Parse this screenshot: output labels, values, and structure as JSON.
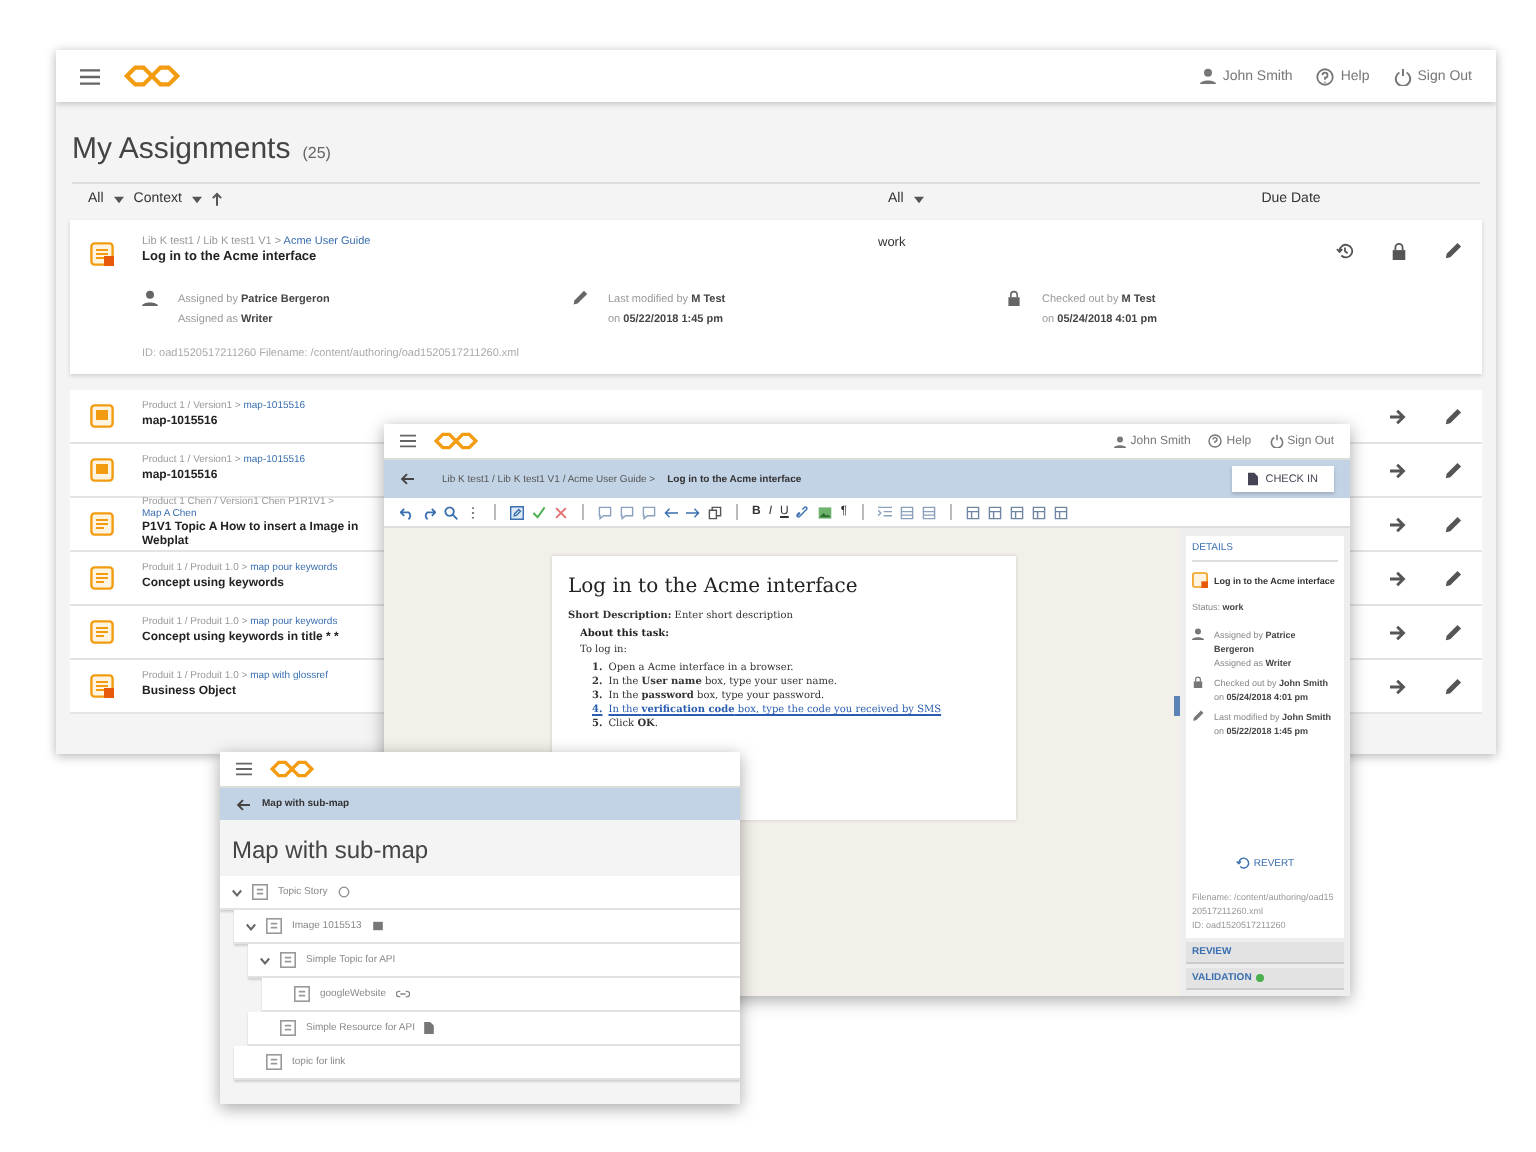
{
  "main_window": {
    "header": {
      "user": "John Smith",
      "help": "Help",
      "sign_out": "Sign Out"
    },
    "title": "My Assignments",
    "count": "(25)",
    "filters": {
      "select_all": "All",
      "context": "Context",
      "status": "All",
      "due_date": "Due Date"
    },
    "featured": {
      "kind": "task",
      "path": "Lib K test1 / Lib K test1 V1 >",
      "link": "Acme User Guide",
      "title": "Log in to the Acme interface",
      "status": "work",
      "assigned_by": "Assigned by **Patrice Bergeron**",
      "assigned_as": "Assigned as **Writer**",
      "modified_by": "Last modified by **M Test**",
      "modified_on": "on **05/22/2018 1:45 pm**",
      "checked_out_by": "Checked out by **M Test**",
      "checked_out_on": "on **05/24/2018 4:01 pm**",
      "ids": "ID: oad1520517211260   Filename: /content/authoring/oad1520517211260.xml"
    },
    "assignments": [
      {
        "kind": "map",
        "path": "Product 1 / Version1 >",
        "link": "map-1015516",
        "title": "map-1015516"
      },
      {
        "kind": "map",
        "path": "Product 1 / Version1 >",
        "link": "map-1015516",
        "title": "map-1015516"
      },
      {
        "kind": "topic",
        "path": "Product 1 Chen / Version1 Chen P1R1V1 >",
        "link": "Map A Chen",
        "title": "P1V1 Topic A How to insert a Image in Webplat"
      },
      {
        "kind": "topic",
        "path": "Produit 1 / Produit 1.0 >",
        "link": "map pour keywords",
        "title": "Concept using keywords"
      },
      {
        "kind": "topic",
        "path": "Produit 1 / Produit 1.0 >",
        "link": "map pour keywords",
        "title": "Concept using keywords in title * *"
      },
      {
        "kind": "task",
        "path": "Produit 1 / Produit 1.0 >",
        "link": "map with glossref",
        "title": "Business Object"
      }
    ]
  },
  "editor_window": {
    "header": {
      "user": "John Smith",
      "help": "Help",
      "sign_out": "Sign Out"
    },
    "path": "Lib K test1 / Lib K test1 V1 / Acme User Guide >",
    "current": "Log in to the Acme interface",
    "check_in": "CHECK IN",
    "format_buttons": [
      "B",
      "I",
      "U"
    ],
    "pilcrow": "¶",
    "document": {
      "title": "Log in to the Acme interface",
      "short_description": "**Short Description:** Enter short description",
      "section": "About this task:",
      "intro": "To log in:",
      "steps": [
        {
          "number": "1.",
          "text": "Open a Acme interface in a browser.",
          "link": false
        },
        {
          "number": "2.",
          "text": "In the **User name** box, type your user name.",
          "link": false
        },
        {
          "number": "3.",
          "text": "In the **password** box, type your password.",
          "link": false
        },
        {
          "number": "4.",
          "text": "In the **verification code** box, type the code you received by SMS",
          "link": true
        },
        {
          "number": "5.",
          "text": "Click **OK**.",
          "link": false
        }
      ]
    },
    "details": {
      "heading": "DETAILS",
      "title": "Log in to the Acme interface",
      "status": "Status: **work**",
      "assigned_by": "Assigned by **Patrice Bergeron**",
      "assigned_as": "Assigned as **Writer**",
      "checked_out_by": "Checked out by **John Smith**",
      "checked_out_on": "on **05/24/2018 4:01 pm**",
      "modified_by": "Last modified by **John Smith**",
      "modified_on": "on **05/22/2018 1:45 pm**",
      "revert": "REVERT",
      "filename": "Filename: /content/authoring/oad1520517211260.xml",
      "id": "ID: oad1520517211260"
    },
    "panels": [
      {
        "label": "REVIEW"
      },
      {
        "label": "VALIDATION",
        "color": "#4caf50"
      }
    ]
  },
  "map_window": {
    "breadcrumb": "Map with sub-map",
    "title": "Map with sub-map",
    "tree": [
      {
        "label": "Topic Story",
        "kind": "submap",
        "expanded": true,
        "children": [
          {
            "label": "Image 1015513",
            "kind": "image",
            "expanded": true,
            "children": [
              {
                "label": "Simple Topic for API",
                "kind": "topic",
                "expanded": true,
                "children": [
                  {
                    "label": "googleWebsite",
                    "kind": "link"
                  }
                ]
              },
              {
                "label": "Simple Resource for API",
                "kind": "resource"
              }
            ]
          },
          {
            "label": "topic for link",
            "kind": "topic"
          }
        ]
      }
    ]
  }
}
